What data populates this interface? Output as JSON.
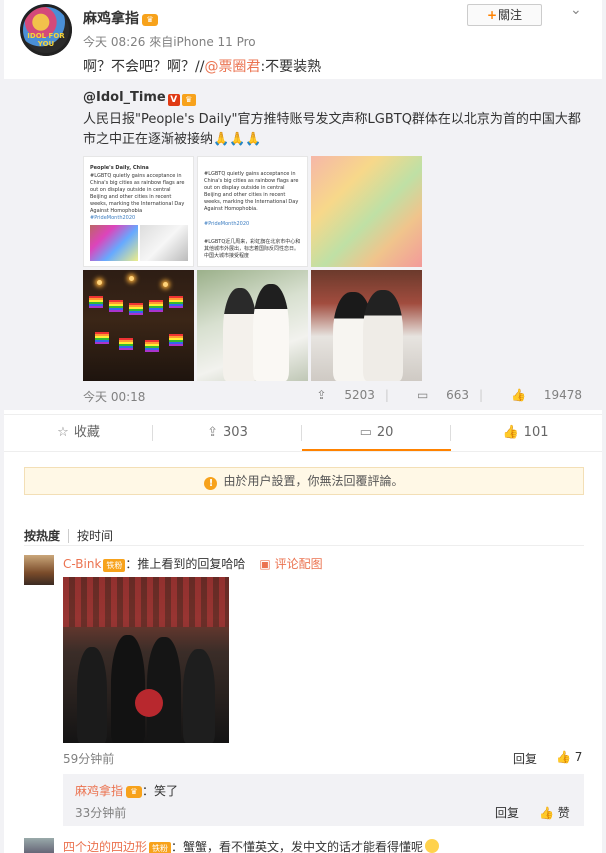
{
  "post": {
    "author": "麻鸡拿指",
    "follow_label": "關注",
    "meta": "今天 08:26 來自iPhone 11 Pro",
    "text_before": "啊？不会吧？啊？//",
    "mention": "@票圈君",
    "text_after": ":不要装熟",
    "avatar_text": "IDOL FOR YOU"
  },
  "repost": {
    "author": "@Idol_Time",
    "text": "人民日报\"People's Daily\"官方推特账号发文声称LGBTQ群体在以北京为首的中国大都市之中正在逐渐被接纳🙏🙏🙏",
    "tweet1": {
      "header": "People's Daily, China",
      "body": "#LGBTQ quietly gains acceptance in China's big cities as rainbow flags are out on display outside in central Beijing and other cities in recent weeks, marking the International Day Against Homophobia",
      "tag": "#PrideMonth2020"
    },
    "tweet2": {
      "body": "#LGBTQ quietly gains acceptance in China's big cities as rainbow flags are out on display outside in central Beijing and other cities in recent weeks, marking the International Day Against Homophobia.",
      "tag": "#PrideMonth2020",
      "cn": "#LGBTQ近几周来，彩虹旗在北京市中心和其他城市外展出，标志着国际反同性恋日。中国大城市接受程度"
    },
    "time": "今天 00:18",
    "reposts": "5203",
    "comments": "663",
    "likes": "19478"
  },
  "actions": {
    "favorite": "收藏",
    "repost": "303",
    "comment": "20",
    "like": "101"
  },
  "notice": "由於用户設置，你無法回覆評論。",
  "sort": {
    "hot": "按热度",
    "time": "按时间"
  },
  "comment1": {
    "user": "C-Bink",
    "fan": "铁粉",
    "text": "：推上看到的回复哈哈",
    "pic_link": "评论配图",
    "time": "59分钟前",
    "reply": "回复",
    "likes": "7"
  },
  "sub1": {
    "user": "麻鸡拿指",
    "text": "：笑了",
    "time": "33分钟前",
    "reply": "回复",
    "like": "赞"
  },
  "comment2": {
    "user": "四个边的四边形",
    "fan": "铁粉",
    "text": "：蟹蟹，看不懂英文，发中文的话才能看得懂呢"
  },
  "colors": {
    "accent": "#eb7350",
    "badge": "#f7a21b",
    "follow_plus": "#ff8200"
  }
}
